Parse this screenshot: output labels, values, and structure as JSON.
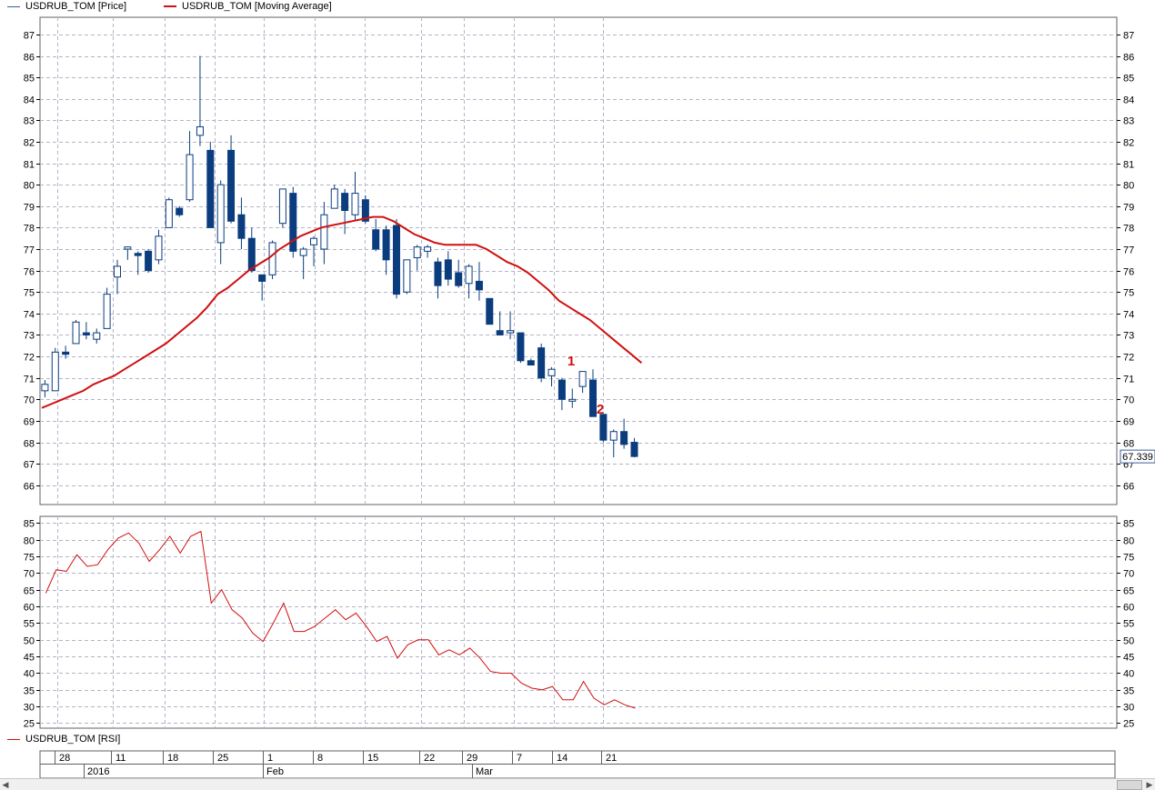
{
  "legend": {
    "price": "USDRUB_TOM [Price]",
    "ma": "USDRUB_TOM [Moving Average]",
    "rsi": "USDRUB_TOM [RSI]"
  },
  "last_price_label": "67.339",
  "annotations": [
    "1",
    "2"
  ],
  "colors": {
    "bull": "#ffffff",
    "bear": "#0a3c7e",
    "candle_outline": "#0a3c7e",
    "ma": "#d01010",
    "rsi": "#d01010",
    "annotation": "#d01010",
    "grid": "#b4b4c8",
    "plot_bg": "#ffffff"
  },
  "chart_data": [
    {
      "type": "candlestick",
      "series_name": "USDRUB_TOM [Price]",
      "y_ticks": [
        66,
        67,
        68,
        69,
        70,
        71,
        72,
        73,
        74,
        75,
        76,
        77,
        78,
        79,
        80,
        81,
        82,
        83,
        84,
        85,
        86,
        87
      ],
      "ylim": [
        65.1,
        87.8
      ],
      "candles": [
        {
          "o": 70.4,
          "h": 70.9,
          "l": 70.1,
          "c": 70.7
        },
        {
          "o": 70.4,
          "h": 72.4,
          "l": 70.4,
          "c": 72.2
        },
        {
          "o": 72.2,
          "h": 72.5,
          "l": 71.9,
          "c": 72.1
        },
        {
          "o": 72.6,
          "h": 73.7,
          "l": 72.6,
          "c": 73.6
        },
        {
          "o": 73.1,
          "h": 73.6,
          "l": 72.8,
          "c": 73.0
        },
        {
          "o": 72.8,
          "h": 73.3,
          "l": 72.6,
          "c": 73.1
        },
        {
          "o": 73.3,
          "h": 75.2,
          "l": 73.3,
          "c": 74.9
        },
        {
          "o": 75.7,
          "h": 76.5,
          "l": 74.9,
          "c": 76.2
        },
        {
          "o": 77.0,
          "h": 77.1,
          "l": 76.5,
          "c": 77.1
        },
        {
          "o": 76.8,
          "h": 76.9,
          "l": 75.8,
          "c": 76.7
        },
        {
          "o": 76.9,
          "h": 77.0,
          "l": 75.9,
          "c": 76.0
        },
        {
          "o": 76.5,
          "h": 77.9,
          "l": 76.3,
          "c": 77.6
        },
        {
          "o": 78.0,
          "h": 79.4,
          "l": 78.0,
          "c": 79.3
        },
        {
          "o": 78.9,
          "h": 79.0,
          "l": 78.5,
          "c": 78.6
        },
        {
          "o": 79.3,
          "h": 82.5,
          "l": 79.2,
          "c": 81.4
        },
        {
          "o": 82.3,
          "h": 86.0,
          "l": 81.8,
          "c": 82.7
        },
        {
          "o": 81.6,
          "h": 82.0,
          "l": 78.0,
          "c": 78.0
        },
        {
          "o": 77.3,
          "h": 80.2,
          "l": 76.3,
          "c": 80.0
        },
        {
          "o": 81.6,
          "h": 82.3,
          "l": 78.2,
          "c": 78.3
        },
        {
          "o": 78.6,
          "h": 79.4,
          "l": 77.0,
          "c": 77.5
        },
        {
          "o": 77.5,
          "h": 78.0,
          "l": 75.9,
          "c": 76.0
        },
        {
          "o": 75.8,
          "h": 75.8,
          "l": 74.6,
          "c": 75.5
        },
        {
          "o": 75.8,
          "h": 77.4,
          "l": 75.6,
          "c": 77.3
        },
        {
          "o": 78.2,
          "h": 79.8,
          "l": 78.0,
          "c": 79.8
        },
        {
          "o": 79.6,
          "h": 79.9,
          "l": 76.6,
          "c": 76.9
        },
        {
          "o": 76.7,
          "h": 77.1,
          "l": 75.6,
          "c": 77.0
        },
        {
          "o": 77.2,
          "h": 77.6,
          "l": 76.2,
          "c": 77.5
        },
        {
          "o": 77.0,
          "h": 79.2,
          "l": 76.3,
          "c": 78.6
        },
        {
          "o": 78.9,
          "h": 80.0,
          "l": 78.9,
          "c": 79.8
        },
        {
          "o": 79.6,
          "h": 79.8,
          "l": 77.7,
          "c": 78.8
        },
        {
          "o": 78.6,
          "h": 80.6,
          "l": 78.3,
          "c": 79.6
        },
        {
          "o": 79.3,
          "h": 79.5,
          "l": 78.2,
          "c": 78.3
        },
        {
          "o": 77.9,
          "h": 78.4,
          "l": 76.9,
          "c": 77.0
        },
        {
          "o": 77.9,
          "h": 78.1,
          "l": 75.8,
          "c": 76.5
        },
        {
          "o": 78.1,
          "h": 78.4,
          "l": 74.7,
          "c": 74.9
        },
        {
          "o": 75.0,
          "h": 76.5,
          "l": 74.9,
          "c": 76.5
        },
        {
          "o": 76.6,
          "h": 77.2,
          "l": 76.0,
          "c": 77.1
        },
        {
          "o": 76.9,
          "h": 77.2,
          "l": 76.6,
          "c": 77.1
        },
        {
          "o": 76.4,
          "h": 76.6,
          "l": 74.7,
          "c": 75.3
        },
        {
          "o": 76.5,
          "h": 76.9,
          "l": 75.3,
          "c": 75.6
        },
        {
          "o": 75.9,
          "h": 76.5,
          "l": 75.2,
          "c": 75.3
        },
        {
          "o": 75.4,
          "h": 76.3,
          "l": 74.7,
          "c": 76.2
        },
        {
          "o": 75.5,
          "h": 76.4,
          "l": 74.6,
          "c": 75.1
        },
        {
          "o": 74.7,
          "h": 74.7,
          "l": 73.5,
          "c": 73.5
        },
        {
          "o": 73.2,
          "h": 74.1,
          "l": 73.1,
          "c": 73.0
        },
        {
          "o": 73.1,
          "h": 74.1,
          "l": 72.8,
          "c": 73.2
        },
        {
          "o": 73.1,
          "h": 73.1,
          "l": 71.7,
          "c": 71.8
        },
        {
          "o": 71.8,
          "h": 71.9,
          "l": 71.6,
          "c": 71.6
        },
        {
          "o": 72.4,
          "h": 72.6,
          "l": 70.8,
          "c": 71.0
        },
        {
          "o": 71.1,
          "h": 71.5,
          "l": 70.6,
          "c": 71.4
        },
        {
          "o": 70.9,
          "h": 71.0,
          "l": 69.5,
          "c": 70.0
        },
        {
          "o": 70.0,
          "h": 70.5,
          "l": 69.6,
          "c": 70.0
        },
        {
          "o": 70.6,
          "h": 71.3,
          "l": 70.3,
          "c": 71.3
        },
        {
          "o": 70.9,
          "h": 71.4,
          "l": 69.2,
          "c": 69.2
        },
        {
          "o": 69.3,
          "h": 69.3,
          "l": 68.0,
          "c": 68.1
        },
        {
          "o": 68.1,
          "h": 68.6,
          "l": 67.3,
          "c": 68.5
        },
        {
          "o": 68.5,
          "h": 69.1,
          "l": 67.7,
          "c": 67.9
        },
        {
          "o": 68.0,
          "h": 68.2,
          "l": 67.3,
          "c": 67.339
        }
      ]
    },
    {
      "type": "line",
      "series_name": "USDRUB_TOM [Moving Average]",
      "values": [
        69.6,
        69.8,
        70.0,
        70.2,
        70.4,
        70.7,
        70.9,
        71.1,
        71.4,
        71.7,
        72.0,
        72.3,
        72.6,
        73.0,
        73.4,
        73.8,
        74.3,
        74.9,
        75.2,
        75.6,
        76.0,
        76.3,
        76.6,
        77.0,
        77.3,
        77.6,
        77.8,
        78.0,
        78.1,
        78.2,
        78.3,
        78.4,
        78.5,
        78.5,
        78.3,
        78.0,
        77.7,
        77.5,
        77.3,
        77.2,
        77.2,
        77.2,
        77.2,
        77.0,
        76.7,
        76.4,
        76.2,
        75.9,
        75.5,
        75.1,
        74.6,
        74.3,
        74.0,
        73.7,
        73.3,
        72.9,
        72.5,
        72.1,
        71.7
      ]
    },
    {
      "type": "line",
      "series_name": "USDRUB_TOM [RSI]",
      "y_ticks": [
        25,
        30,
        35,
        40,
        45,
        50,
        55,
        60,
        65,
        70,
        75,
        80,
        85
      ],
      "ylim": [
        23.5,
        87.0
      ],
      "values": [
        64,
        71,
        70.5,
        75.5,
        72,
        72.5,
        77,
        80.5,
        82,
        79,
        73.5,
        77,
        81,
        76,
        81,
        82.5,
        61,
        65,
        59,
        56.5,
        52,
        49.5,
        55,
        61,
        52.5,
        52.5,
        54,
        56.5,
        59,
        56,
        58,
        54,
        49.5,
        51,
        44.5,
        48.5,
        50,
        50,
        45.5,
        47,
        45.5,
        47.5,
        44.5,
        40.5,
        40,
        40,
        37,
        35.5,
        35,
        36,
        32,
        32,
        37.5,
        32.5,
        30.5,
        32,
        30.5,
        29.5
      ]
    }
  ],
  "x_axis": {
    "day_labels": [
      "28",
      "11",
      "18",
      "25",
      "1",
      "8",
      "15",
      "22",
      "29",
      "7",
      "14",
      "21"
    ],
    "period_labels": [
      "2016",
      "Feb",
      "Mar"
    ]
  }
}
